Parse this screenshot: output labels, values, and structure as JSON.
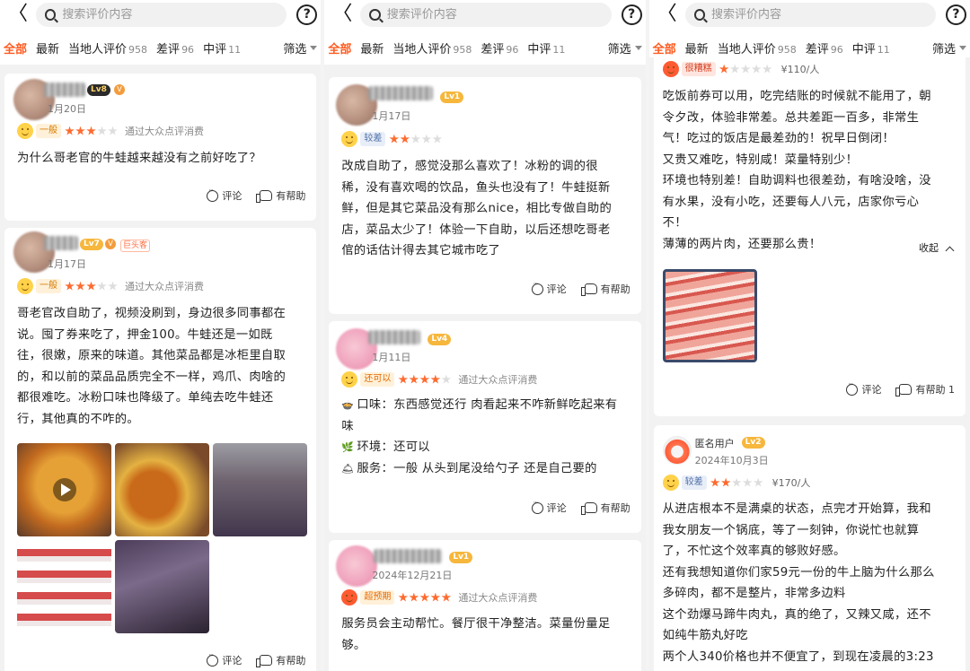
{
  "header": {
    "back_glyph": "〈",
    "search_placeholder": "搜索评价内容",
    "help_glyph": "?"
  },
  "tabs": [
    {
      "label": "全部",
      "count": ""
    },
    {
      "label": "最新",
      "count": ""
    },
    {
      "label": "当地人评价",
      "count": "958"
    },
    {
      "label": "差评",
      "count": "96"
    },
    {
      "label": "中评",
      "count": "11"
    }
  ],
  "filter_label": "筛选",
  "actions": {
    "comment": "评论",
    "helpful": "有帮助",
    "helpful_one": "有帮助 1",
    "collapse": "收起"
  },
  "screen1": {
    "review1": {
      "level": "Lv8",
      "date": "1月20日",
      "rating_label": "一般",
      "stars": 3,
      "via": "通过大众点评消费",
      "text": "为什么哥老官的牛蛙越来越没有之前好吃了？"
    },
    "review2": {
      "level": "Lv7",
      "badge": "巨头客",
      "date": "1月17日",
      "rating_label": "一般",
      "stars": 3,
      "via": "通过大众点评消费",
      "lines": [
        "哥老官改自助了，视频没刷到，身边很多同事都在",
        "说。囤了券来吃了，押金100。牛蛙还是一如既",
        "往，很嫩，原来的味道。其他菜品都是冰柜里自取",
        "的，和以前的菜品品质完全不一样，鸡爪、肉啥的",
        "都很难吃。冰粉口味也降级了。单纯去吃牛蛙还",
        "行，其他真的不咋的。"
      ]
    },
    "review3_actions": true
  },
  "screen2": {
    "review1": {
      "level": "Lv1",
      "date": "1月17日",
      "rating_label": "较差",
      "stars": 2,
      "lines": [
        "改成自助了，感觉没那么喜欢了！冰粉的调的很",
        "稀，没有喜欢喝的饮品，鱼头也没有了！牛蛙挺新",
        "鲜，但是其它菜品没有那么nice，相比专做自助的",
        "店，菜品太少了！体验一下自助，以后还想吃哥老",
        "倌的话估计得去其它城市吃了"
      ]
    },
    "review2": {
      "level": "Lv4",
      "date": "1月11日",
      "rating_label": "还可以",
      "stars": 4,
      "via": "通过大众点评消费",
      "taste": "口味：东西感觉还行 肉看起来不咋新鲜吃起来有",
      "taste2": "味",
      "env": "环境：还可以",
      "service": "服务：一般 从头到尾没给勺子 还是自己要的"
    },
    "review3": {
      "level": "Lv1",
      "date": "2024年12月21日",
      "rating_label": "超预期",
      "stars": 5,
      "via": "通过大众点评消费",
      "lines": [
        "服务员会主动帮忙。餐厅很干净整洁。菜量份量足",
        "够。"
      ]
    }
  },
  "screen3": {
    "review1": {
      "rating_label": "很糟糕",
      "stars": 1,
      "price": "¥110/人",
      "lines": [
        "吃饭前券可以用，吃完结账的时候就不能用了，朝",
        "令夕改，体验非常差。总共差距一百多，非常生",
        "气！吃过的饭店是最差劲的！祝早日倒闭！",
        "又贵又难吃，特别咸！菜量特别少！",
        "环境也特别差！自助调料也很差劲，有啥没啥，没",
        "有水果，没有小吃，还要每人八元，店家你亏心",
        "不！",
        "薄薄的两片肉，还要那么贵！"
      ]
    },
    "review2": {
      "username": "匿名用户",
      "level": "Lv2",
      "date": "2024年10月3日",
      "rating_label": "较差",
      "stars": 2,
      "price": "¥170/人",
      "lines": [
        "从进店根本不是满桌的状态，点完才开始算，我和",
        "我女朋友一个锅底，等了一刻钟，你说忙也就算",
        "了，不忙这个效率真的够败好感。",
        "还有我想知道你们家59元一份的牛上脑为什么那么",
        "多碎肉，都不是整片，非常多边料",
        "这个劲爆马蹄牛肉丸，真的绝了，又辣又咸，还不",
        "如纯牛筋丸好吃",
        "两个人340价格也并不便宜了，到现在凌晨的3:23"
      ]
    }
  },
  "colors": {
    "accent": "#ff5a1f",
    "star_on": "#ff6a2e",
    "star_off": "#dddddd"
  }
}
